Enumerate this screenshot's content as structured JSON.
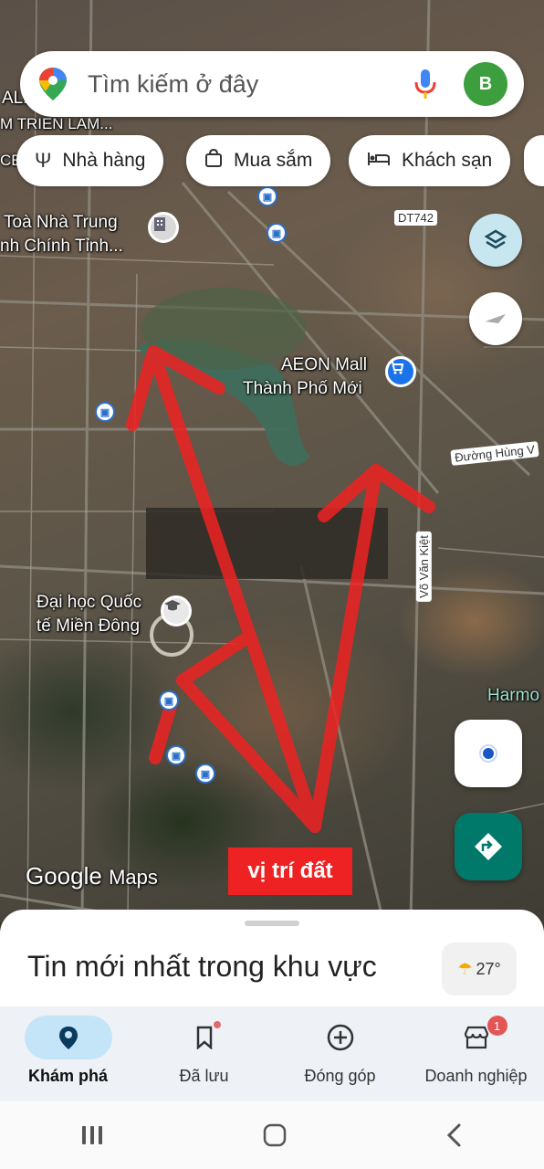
{
  "search": {
    "placeholder": "Tìm kiếm ở đây",
    "avatar_letter": "B"
  },
  "chips": [
    "Nhà hàng",
    "Mua sắm",
    "Khách sạn"
  ],
  "map_labels": {
    "building": [
      "Toà Nhà Trung",
      "nh Chính Tỉnh..."
    ],
    "exhibit": "M TRIEN LAM...",
    "aeon": [
      "AEON Mall",
      "Thành Phố Mới"
    ],
    "university": [
      "Đại học Quốc",
      "tế Miền Đông"
    ],
    "road_dt742": "DT742",
    "road_hung_vuong": "Đường Hùng V",
    "road_vo_van_kiet": "Võ Văn Kiệt",
    "harmony": "Harmo",
    "left_edge_top": "ALL",
    "left_edge_ce": "CE"
  },
  "annotation": {
    "label": "vị trí đất",
    "arrow_color": "#ee2222"
  },
  "watermark": {
    "brand": "Google",
    "product": "Maps"
  },
  "sheet": {
    "title": "Tin mới nhất trong khu vực",
    "weather": "27°"
  },
  "bottom_nav": [
    {
      "label": "Khám phá",
      "icon": "location-pin-icon",
      "active": true
    },
    {
      "label": "Đã lưu",
      "icon": "bookmark-icon",
      "active": false
    },
    {
      "label": "Đóng góp",
      "icon": "add-circle-icon",
      "active": false
    },
    {
      "label": "Doanh nghiệp",
      "icon": "storefront-icon",
      "active": false,
      "badge": "1"
    }
  ],
  "colors": {
    "accent": "#1a73e8",
    "directions_fab": "#00796b",
    "active_tab": "#c4e4f8"
  }
}
